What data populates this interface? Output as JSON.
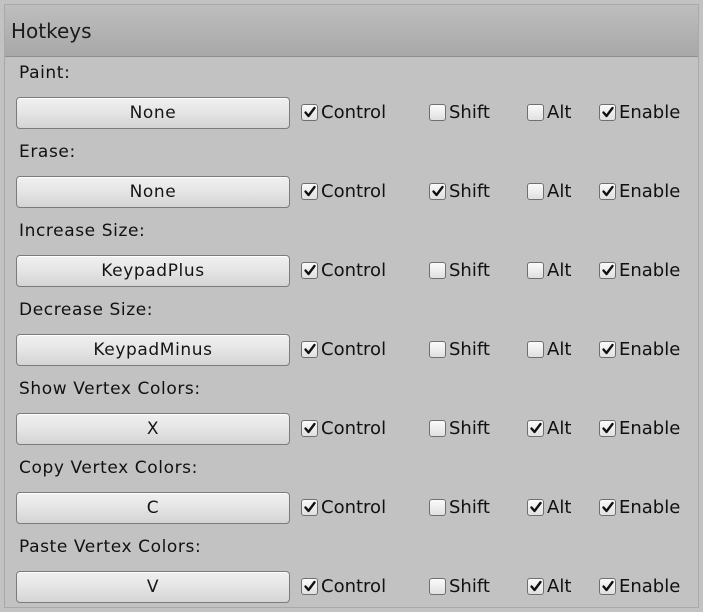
{
  "panel": {
    "title": "Hotkeys"
  },
  "toggle_labels": {
    "control": "Control",
    "shift": "Shift",
    "alt": "Alt",
    "enable": "Enable"
  },
  "hotkeys": [
    {
      "label": "Paint:",
      "key": "None",
      "control": true,
      "shift": false,
      "alt": false,
      "enable": true
    },
    {
      "label": "Erase:",
      "key": "None",
      "control": true,
      "shift": true,
      "alt": false,
      "enable": true
    },
    {
      "label": "Increase Size:",
      "key": "KeypadPlus",
      "control": true,
      "shift": false,
      "alt": false,
      "enable": true
    },
    {
      "label": "Decrease Size:",
      "key": "KeypadMinus",
      "control": true,
      "shift": false,
      "alt": false,
      "enable": true
    },
    {
      "label": "Show Vertex Colors:",
      "key": "X",
      "control": true,
      "shift": false,
      "alt": true,
      "enable": true
    },
    {
      "label": "Copy Vertex Colors:",
      "key": "C",
      "control": true,
      "shift": false,
      "alt": true,
      "enable": true
    },
    {
      "label": "Paste Vertex Colors:",
      "key": "V",
      "control": true,
      "shift": false,
      "alt": true,
      "enable": true
    }
  ],
  "icons": {
    "checkbox": "checkbox-icon",
    "checkmark": "checkmark-icon"
  }
}
